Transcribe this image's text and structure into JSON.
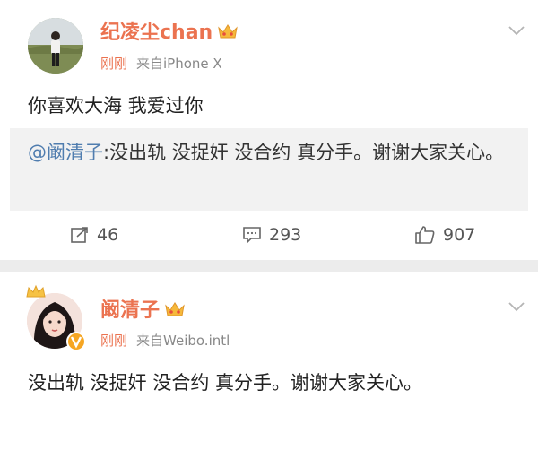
{
  "posts": [
    {
      "username": "纪凌尘chan",
      "time": "刚刚",
      "source": "来自iPhone X",
      "content": "你喜欢大海 我爱过你",
      "repost": {
        "mention": "@阚清子",
        "text": ":没出轨 没捉奸 没合约 真分手。谢谢大家关心。"
      },
      "actions": {
        "share_count": "46",
        "comment_count": "293",
        "like_count": "907"
      }
    },
    {
      "username": "阚清子",
      "time": "刚刚",
      "source": "来自Weibo.intl",
      "content": "没出轨 没捉奸 没合约 真分手。谢谢大家关心。"
    }
  ],
  "colors": {
    "username": "#eb7350",
    "mention": "#507daf",
    "meta": "#888888",
    "repost_bg": "#f2f2f2"
  },
  "icons": [
    "vip-crown-icon",
    "chevron-down-icon",
    "share-icon",
    "comment-icon",
    "like-icon",
    "verified-badge-icon",
    "crown-icon"
  ]
}
